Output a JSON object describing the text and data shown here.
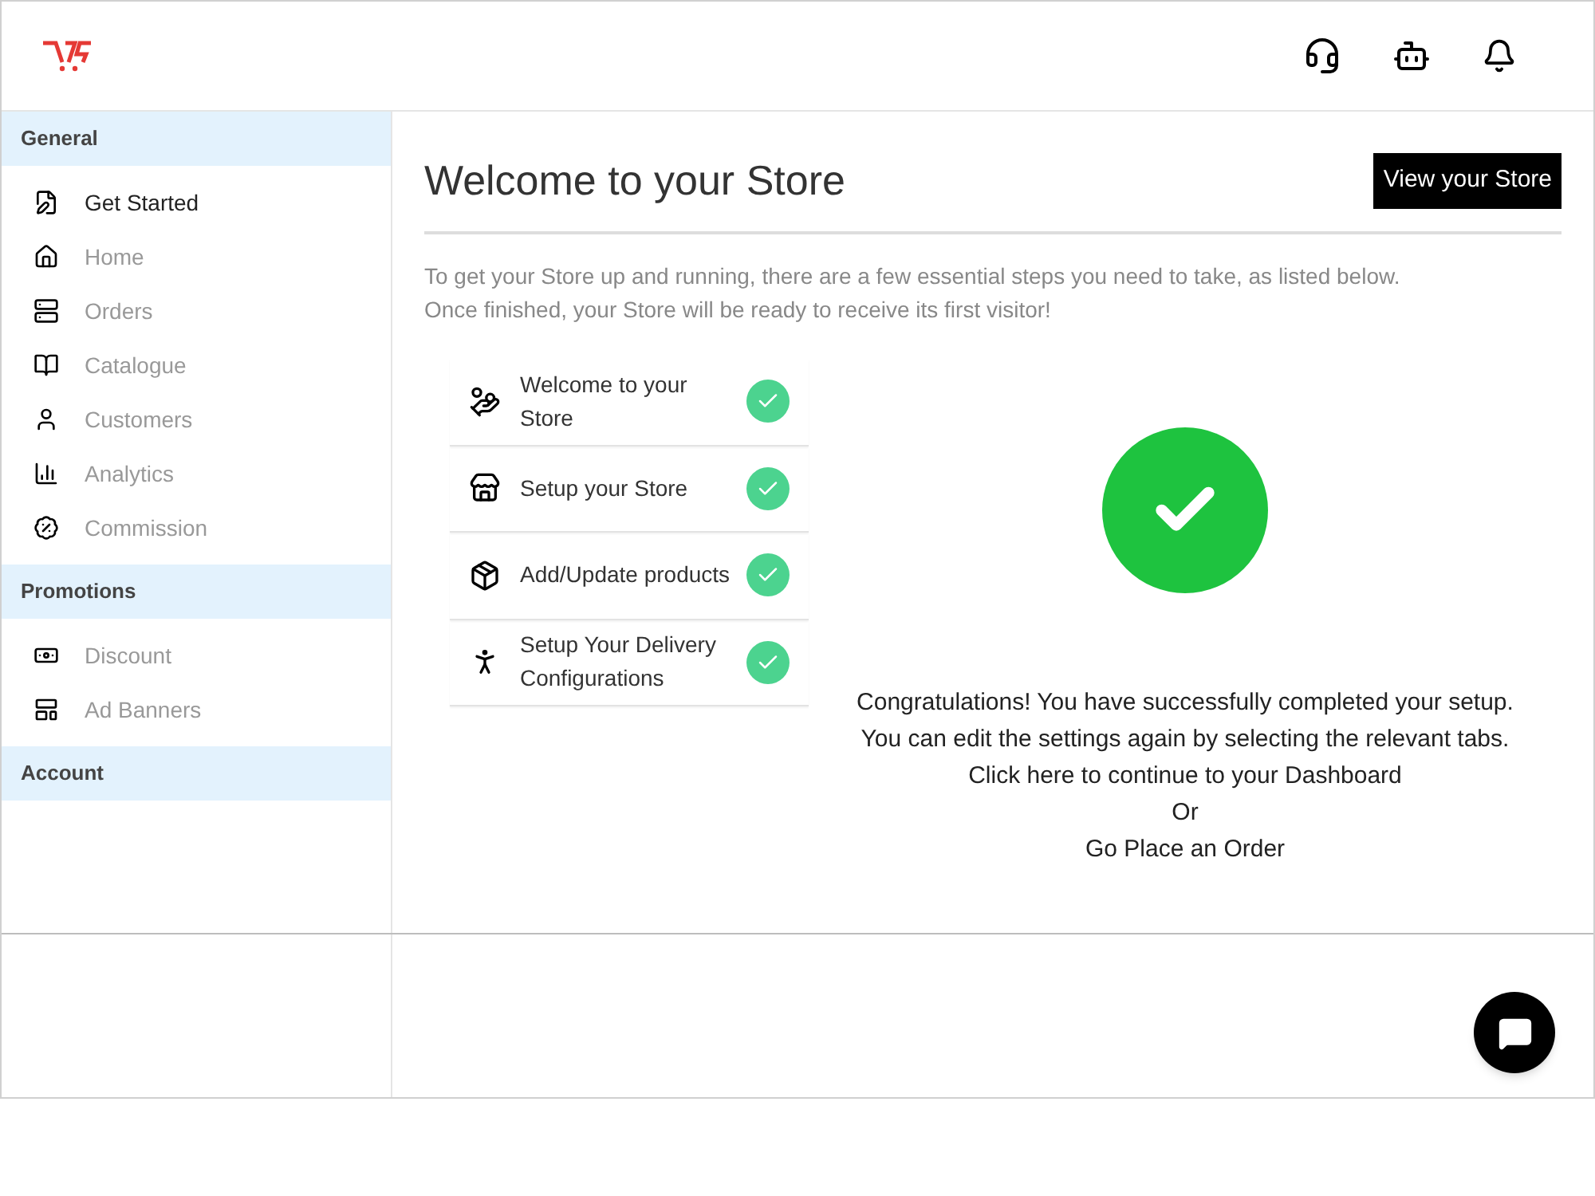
{
  "sidebar": {
    "sections": [
      {
        "title": "General",
        "items": [
          {
            "label": "Get Started",
            "selected": true
          },
          {
            "label": "Home",
            "selected": false
          },
          {
            "label": "Orders",
            "selected": false
          },
          {
            "label": "Catalogue",
            "selected": false
          },
          {
            "label": "Customers",
            "selected": false
          },
          {
            "label": "Analytics",
            "selected": false
          },
          {
            "label": "Commission",
            "selected": false
          }
        ]
      },
      {
        "title": "Promotions",
        "items": [
          {
            "label": "Discount",
            "selected": false
          },
          {
            "label": "Ad Banners",
            "selected": false
          }
        ]
      },
      {
        "title": "Account"
      }
    ]
  },
  "main": {
    "title": "Welcome to your Store",
    "view_button": "View your Store",
    "intro": [
      "To get your Store up and running, there are a few essential steps you need to take, as listed below.",
      "Once finished, your Store will be ready to receive its first visitor!"
    ],
    "steps": [
      {
        "label": "Welcome to your Store",
        "done": true
      },
      {
        "label": "Setup your Store",
        "done": true
      },
      {
        "label": "Add/Update products",
        "done": true
      },
      {
        "label": "Setup Your Delivery Configurations",
        "done": true
      }
    ],
    "complete": {
      "done": true,
      "lines": [
        "Congratulations! You have successfully completed your setup.",
        "You can edit the settings again by selecting the relevant tabs."
      ],
      "dashboard_link": "Click here to continue to your Dashboard",
      "or": "Or",
      "order_link": "Go Place an Order"
    }
  }
}
